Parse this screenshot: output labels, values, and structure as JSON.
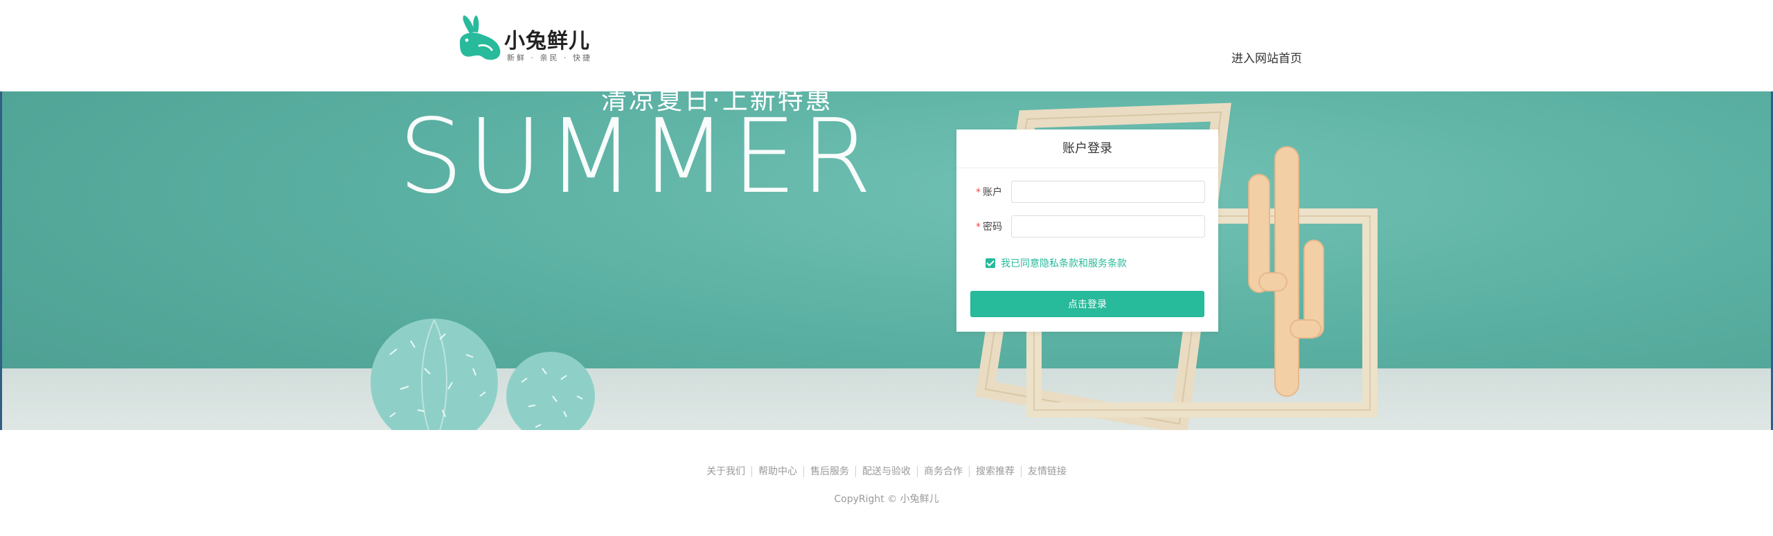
{
  "brand": {
    "name": "小兔鲜儿",
    "slogan": "新鲜 · 亲民 · 快捷",
    "accent": "#27ba9b"
  },
  "header": {
    "home_link": "进入网站首页"
  },
  "banner": {
    "subtitle": "清凉夏日·上新特惠",
    "title": "SUMMER"
  },
  "login": {
    "title": "账户登录",
    "account_label": "账户",
    "password_label": "密码",
    "account_value": "",
    "password_value": "",
    "agree_checked": true,
    "agree_text": "我已同意隐私条款和服务条款",
    "submit_label": "点击登录"
  },
  "footer": {
    "links": [
      "关于我们",
      "帮助中心",
      "售后服务",
      "配送与验收",
      "商务合作",
      "搜索推荐",
      "友情链接"
    ],
    "copyright": "CopyRight © 小兔鲜儿"
  }
}
